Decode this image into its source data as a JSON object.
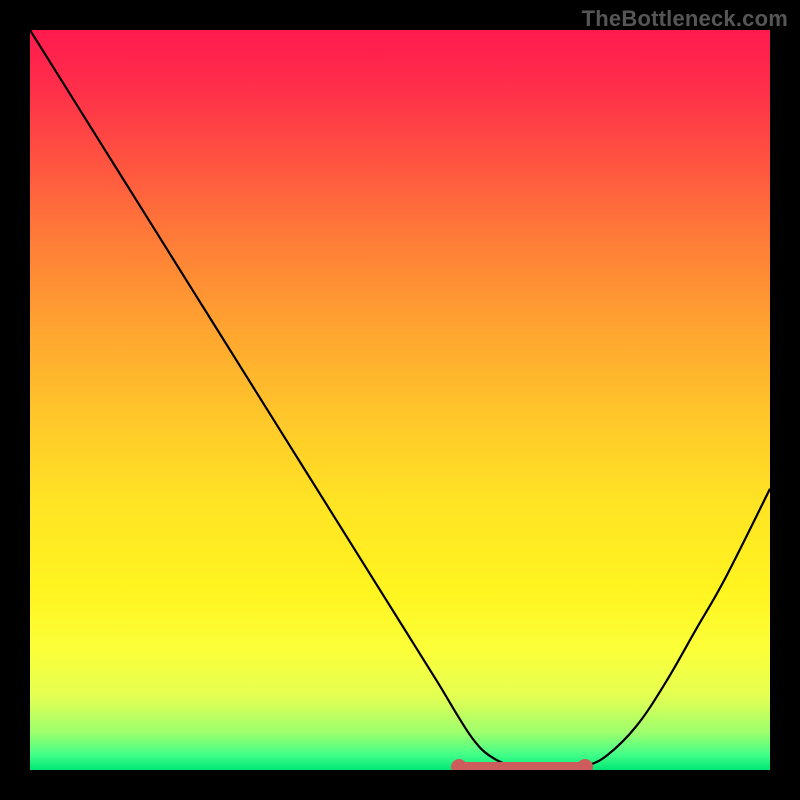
{
  "watermark": "TheBottleneck.com",
  "chart_data": {
    "type": "line",
    "title": "",
    "xlabel": "",
    "ylabel": "",
    "xlim": [
      0,
      100
    ],
    "ylim": [
      0,
      100
    ],
    "x": [
      0,
      5,
      10,
      15,
      20,
      25,
      30,
      35,
      40,
      45,
      50,
      55,
      58,
      60,
      62,
      65,
      68,
      70,
      72,
      75,
      78,
      82,
      86,
      90,
      94,
      100
    ],
    "y": [
      100,
      92,
      84,
      76,
      68,
      60,
      52,
      44,
      36,
      28,
      20,
      12,
      7,
      4,
      2,
      0.5,
      0,
      0,
      0,
      0.5,
      2,
      6,
      12,
      19,
      26,
      38
    ],
    "markers": {
      "x_start": 58,
      "x_end": 75,
      "y": 0
    },
    "colors": {
      "curve": "#000000",
      "marker": "#cd5c5c",
      "gradient_top": "#ff1a4e",
      "gradient_bottom": "#00e676"
    }
  }
}
